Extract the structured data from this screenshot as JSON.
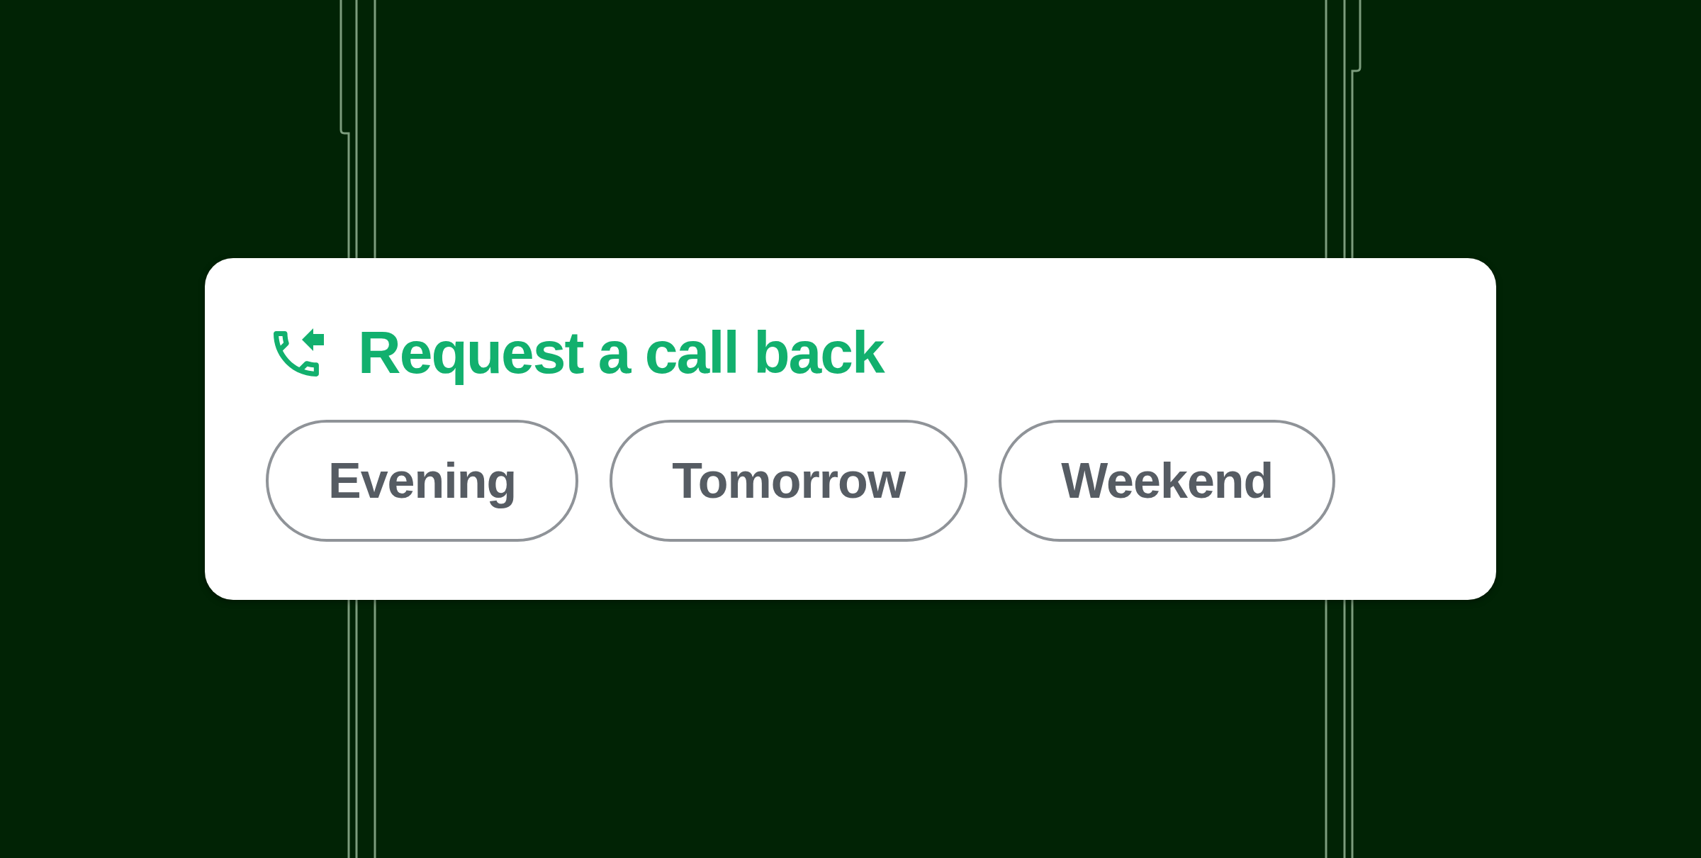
{
  "card": {
    "title": "Request a call back",
    "options": [
      {
        "label": "Evening",
        "selected": false
      },
      {
        "label": "Tomorrow",
        "selected": false
      },
      {
        "label": "Weekend",
        "selected": false
      }
    ]
  }
}
